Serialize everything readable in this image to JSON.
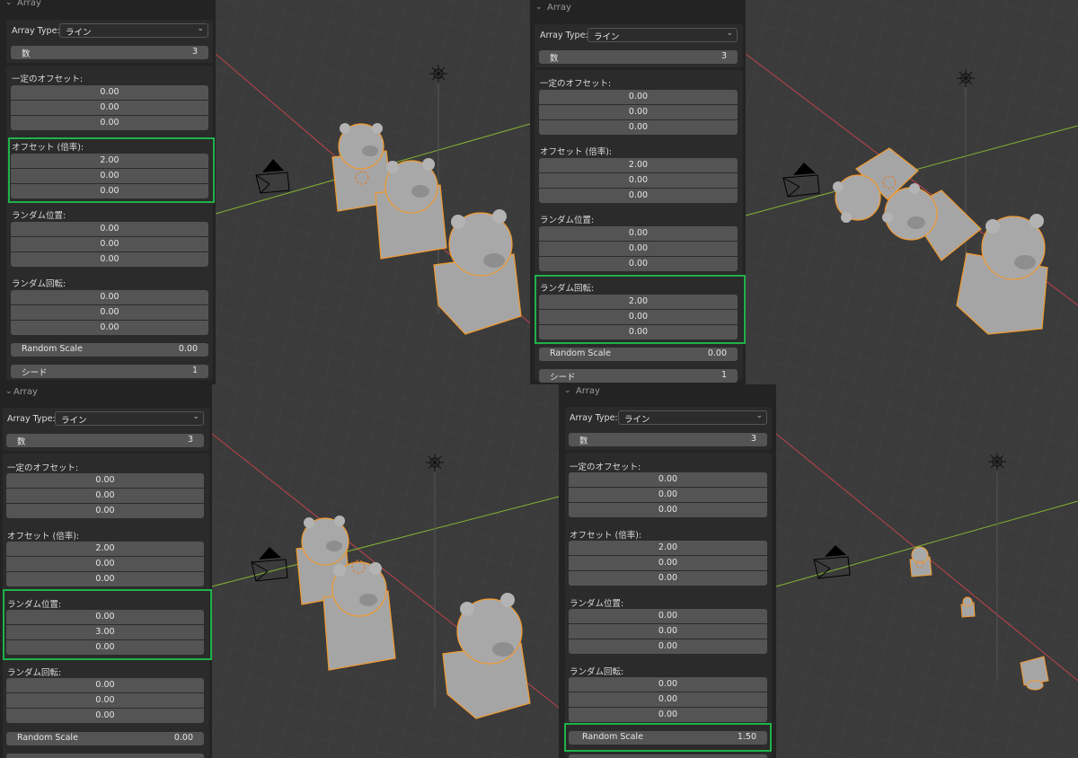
{
  "panels": [
    {
      "title": "Array",
      "array_type_label": "Array Type:",
      "array_type_value": "ライン",
      "count_label": "数",
      "count_value": "3",
      "constant_offset_label": "一定のオフセット:",
      "constant_offset": [
        "0.00",
        "0.00",
        "0.00"
      ],
      "relative_offset_label": "オフセット (倍率):",
      "relative_offset": [
        "2.00",
        "0.00",
        "0.00"
      ],
      "random_position_label": "ランダム位置:",
      "random_position": [
        "0.00",
        "0.00",
        "0.00"
      ],
      "random_rotation_label": "ランダム回転:",
      "random_rotation": [
        "0.00",
        "0.00",
        "0.00"
      ],
      "random_scale_label": "Random Scale",
      "random_scale_value": "0.00",
      "seed_label": "シード",
      "seed_value": "1"
    },
    {
      "title": "Array",
      "array_type_label": "Array Type:",
      "array_type_value": "ライン",
      "count_label": "数",
      "count_value": "3",
      "constant_offset_label": "一定のオフセット:",
      "constant_offset": [
        "0.00",
        "0.00",
        "0.00"
      ],
      "relative_offset_label": "オフセット (倍率):",
      "relative_offset": [
        "2.00",
        "0.00",
        "0.00"
      ],
      "random_position_label": "ランダム位置:",
      "random_position": [
        "0.00",
        "0.00",
        "0.00"
      ],
      "random_rotation_label": "ランダム回転:",
      "random_rotation": [
        "2.00",
        "0.00",
        "0.00"
      ],
      "random_scale_label": "Random Scale",
      "random_scale_value": "0.00",
      "seed_label": "シード",
      "seed_value": "1"
    },
    {
      "title": "Array",
      "array_type_label": "Array Type:",
      "array_type_value": "ライン",
      "count_label": "数",
      "count_value": "3",
      "constant_offset_label": "一定のオフセット:",
      "constant_offset": [
        "0.00",
        "0.00",
        "0.00"
      ],
      "relative_offset_label": "オフセット (倍率):",
      "relative_offset": [
        "2.00",
        "0.00",
        "0.00"
      ],
      "random_position_label": "ランダム位置:",
      "random_position": [
        "0.00",
        "3.00",
        "0.00"
      ],
      "random_rotation_label": "ランダム回転:",
      "random_rotation": [
        "0.00",
        "0.00",
        "0.00"
      ],
      "random_scale_label": "Random Scale",
      "random_scale_value": "0.00"
    },
    {
      "title": "Array",
      "array_type_label": "Array Type:",
      "array_type_value": "ライン",
      "count_label": "数",
      "count_value": "3",
      "constant_offset_label": "一定のオフセット:",
      "constant_offset": [
        "0.00",
        "0.00",
        "0.00"
      ],
      "relative_offset_label": "オフセット (倍率):",
      "relative_offset": [
        "2.00",
        "0.00",
        "0.00"
      ],
      "random_position_label": "ランダム位置:",
      "random_position": [
        "0.00",
        "0.00",
        "0.00"
      ],
      "random_rotation_label": "ランダム回転:",
      "random_rotation": [
        "0.00",
        "0.00",
        "0.00"
      ],
      "random_scale_label": "Random Scale",
      "random_scale_value": "1.50"
    }
  ],
  "icons": {
    "collapse": "chevron-down-icon",
    "dropdown": "caret-down-icon",
    "camera": "camera-icon",
    "light": "light-icon"
  },
  "colors": {
    "viewport_bg": "#3b3b3b",
    "panel_bg": "#232323",
    "field_bg": "#545454",
    "highlight": "#1fb24a",
    "selection_outline": "#f29a2e",
    "x_axis": "#c0434b",
    "y_axis": "#84b533"
  }
}
